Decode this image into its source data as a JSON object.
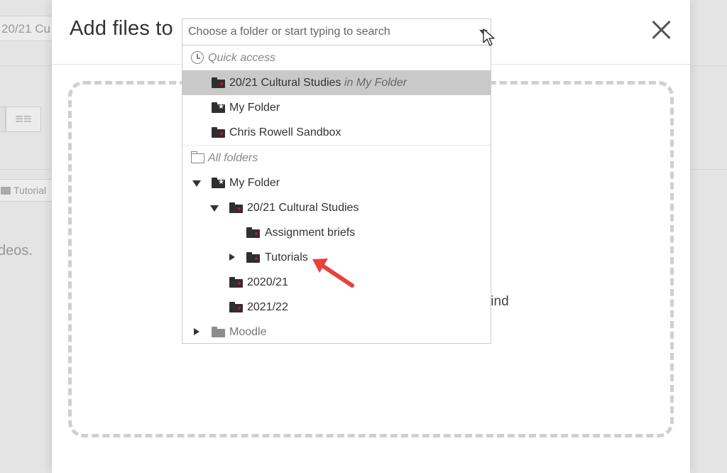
{
  "background": {
    "breadcrumb": "20/21 Cu",
    "tag_label": "Tutorial",
    "text_fragment": "deos.",
    "view_icon": "≡≡"
  },
  "modal": {
    "title": "Add files to",
    "close_icon": "close-icon",
    "drop_text": "find"
  },
  "folder_select": {
    "placeholder": "Choose a folder or start typing to search",
    "value": ""
  },
  "dropdown": {
    "quick_access": {
      "heading": "Quick access",
      "items": [
        {
          "label": "20/21 Cultural Studies",
          "context": "in My Folder",
          "selected": true
        },
        {
          "label": "My Folder"
        },
        {
          "label": "Chris Rowell Sandbox"
        }
      ]
    },
    "all_folders": {
      "heading": "All folders",
      "items": [
        {
          "label": "My Folder"
        },
        {
          "label": "20/21 Cultural Studies"
        },
        {
          "label": "Assignment briefs"
        },
        {
          "label": "Tutorials"
        },
        {
          "label": "2020/21"
        },
        {
          "label": "2021/22"
        },
        {
          "label": "Moodle"
        }
      ]
    }
  },
  "colors": {
    "accent_arrow": "#e8413e",
    "selected_bg": "#c9c9c9",
    "folder_dot": "#c8102e"
  }
}
